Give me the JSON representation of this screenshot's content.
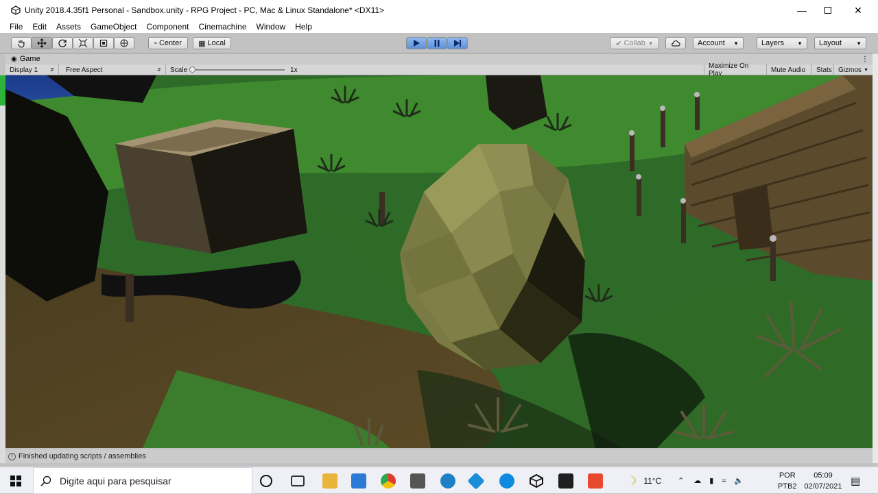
{
  "window": {
    "title": "Unity 2018.4.35f1 Personal - Sandbox.unity - RPG Project - PC, Mac & Linux Standalone* <DX11>"
  },
  "menu": [
    "File",
    "Edit",
    "Assets",
    "GameObject",
    "Component",
    "Cinemachine",
    "Window",
    "Help"
  ],
  "toolbar": {
    "center_label": "Center",
    "local_label": "Local",
    "collab_label": "Collab",
    "account_label": "Account",
    "layers_label": "Layers",
    "layout_label": "Layout"
  },
  "game_tab": {
    "label": "Game"
  },
  "game_bar": {
    "display": "Display 1",
    "aspect": "Free Aspect",
    "scale_label": "Scale",
    "scale_value": "1x",
    "maximize": "Maximize On Play",
    "mute": "Mute Audio",
    "stats": "Stats",
    "gizmos": "Gizmos"
  },
  "status": {
    "message": "Finished updating scripts / assemblies"
  },
  "taskbar": {
    "search_placeholder": "Digite aqui para pesquisar",
    "temperature": "11°C",
    "lang": "POR",
    "layout": "PTB2",
    "time": "05:09",
    "date": "02/07/2021"
  }
}
